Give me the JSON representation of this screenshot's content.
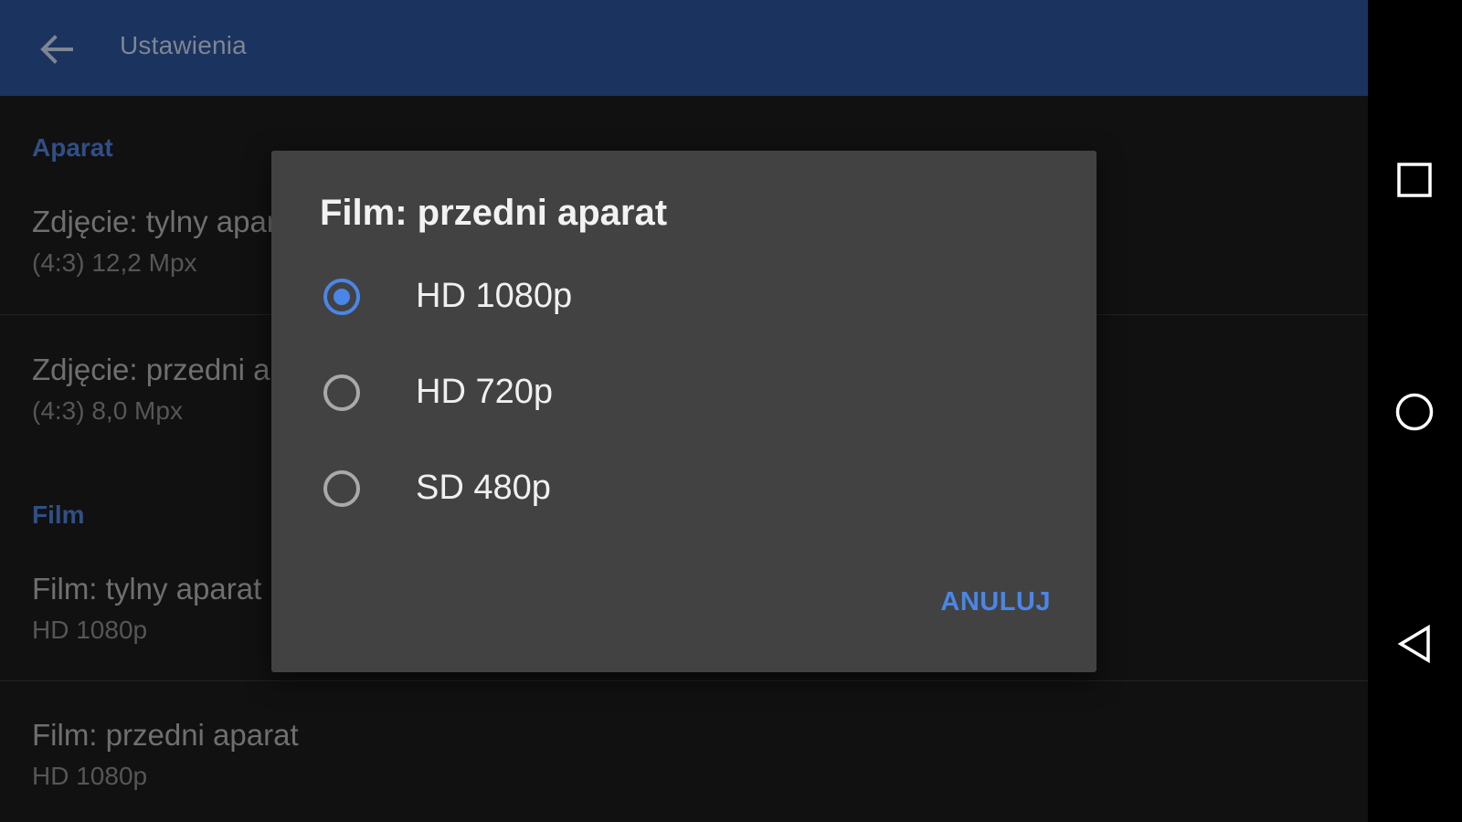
{
  "appbar": {
    "title": "Ustawienia",
    "back_icon": "arrow-left-icon"
  },
  "settings": {
    "sections": [
      {
        "header": "Aparat",
        "items": [
          {
            "title": "Zdjęcie: tylny aparat",
            "summary": "(4:3) 12,2 Mpx"
          },
          {
            "title": "Zdjęcie: przedni aparat",
            "summary": "(4:3) 8,0 Mpx"
          }
        ]
      },
      {
        "header": "Film",
        "items": [
          {
            "title": "Film: tylny aparat",
            "summary": "HD 1080p"
          },
          {
            "title": "Film: przedni aparat",
            "summary": "HD 1080p"
          }
        ]
      }
    ]
  },
  "dialog": {
    "title": "Film: przedni aparat",
    "selected_index": 0,
    "options": [
      {
        "label": "HD 1080p",
        "checked": true
      },
      {
        "label": "HD 720p",
        "checked": false
      },
      {
        "label": "SD 480p",
        "checked": false
      }
    ],
    "cancel_label": "ANULUJ"
  },
  "navbar": {
    "icons": [
      "recents-square-icon",
      "home-circle-icon",
      "back-triangle-icon"
    ]
  },
  "colors": {
    "appbar": "#1a335f",
    "accent": "#4a86e8",
    "dialog_bg": "#424242",
    "screen_bg": "#111111"
  }
}
